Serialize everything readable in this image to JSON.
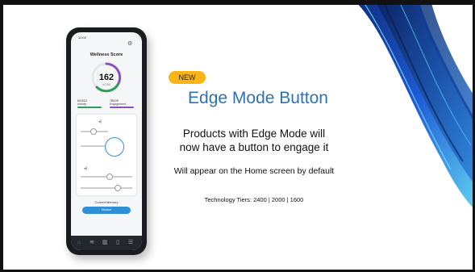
{
  "slide": {
    "badge": "NEW",
    "title": "Edge Mode Button",
    "subtitle_line1": "Products with Edge Mode will",
    "subtitle_line2": "now have a button to engage it",
    "detail": "Will appear on the Home screen by default",
    "tiers": "Technology Tiers: 2400  |  2000 |  1600"
  },
  "phone": {
    "status_time": "10:02",
    "screen_title": "Wellness Score",
    "score": "162",
    "score_of": "of 200",
    "stats": [
      {
        "value": "6/10/10",
        "label": "Activity",
        "color": "#2e9e5b"
      },
      {
        "value": "78/100",
        "label": "Engagement",
        "color": "#8a4fc2"
      }
    ],
    "memory_label": "Current Memory",
    "memory_value": "Normal",
    "accent": "#2f8fd8"
  },
  "icons": [
    "settings-icon",
    "volume-icon",
    "home-icon",
    "activity-icon",
    "stats-icon",
    "device-icon",
    "menu-icon"
  ]
}
